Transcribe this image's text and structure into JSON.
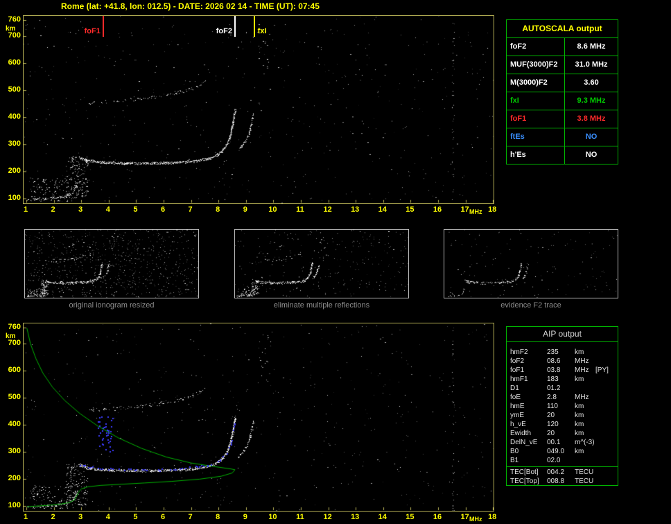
{
  "header": {
    "title": "Rome (lat: +41.8, lon: 012.5) - DATE: 2026 02 14 - TIME (UT): 07:45"
  },
  "colors": {
    "background": "#000000",
    "axis_label": "#FFFF00",
    "plot_border": "#B9B356",
    "table_border": "#00B400",
    "caption_gray": "#8C8C8C",
    "foF1_red": "#FF2A2A",
    "fxI_green": "#00CC00",
    "ftEs_blue": "#3A8FFF",
    "profile_green": "#00B400",
    "restored_blue": "#3C3CFF"
  },
  "autoscala": {
    "header": "AUTOSCALA output",
    "rows": [
      {
        "label": "foF2",
        "value": "8.6 MHz",
        "color": "#FFFFFF"
      },
      {
        "label": "MUF(3000)F2",
        "value": "31.0 MHz",
        "color": "#FFFFFF"
      },
      {
        "label": "M(3000)F2",
        "value": "3.60",
        "color": "#FFFFFF"
      },
      {
        "label": "fxI",
        "value": "9.3 MHz",
        "color": "#00CC00"
      },
      {
        "label": "foF1",
        "value": "3.8 MHz",
        "color": "#FF2A2A"
      },
      {
        "label": "ftEs",
        "value": "NO",
        "color": "#3A8FFF"
      },
      {
        "label": "h'Es",
        "value": "NO",
        "color": "#FFFFFF"
      }
    ]
  },
  "thumbnails": [
    {
      "caption": "original ionogram resized"
    },
    {
      "caption": "eliminate multiple reflections"
    },
    {
      "caption": "evidence F2 trace"
    }
  ],
  "aip": {
    "header": "AIP output",
    "rows": [
      {
        "label": "hmF2",
        "value": "235",
        "unit": "km",
        "extra": ""
      },
      {
        "label": "foF2",
        "value": "08.6",
        "unit": "MHz",
        "extra": ""
      },
      {
        "label": "foF1",
        "value": "03.8",
        "unit": "MHz",
        "extra": "[PY]"
      },
      {
        "label": "hmF1",
        "value": "183",
        "unit": "km",
        "extra": ""
      },
      {
        "label": "D1",
        "value": "01.2",
        "unit": "",
        "extra": ""
      },
      {
        "label": "foE",
        "value": "2.8",
        "unit": "MHz",
        "extra": ""
      },
      {
        "label": "hmE",
        "value": "110",
        "unit": "km",
        "extra": ""
      },
      {
        "label": "ymE",
        "value": "20",
        "unit": "km",
        "extra": ""
      },
      {
        "label": "h_vE",
        "value": "120",
        "unit": "km",
        "extra": ""
      },
      {
        "label": "Ewidth",
        "value": "20",
        "unit": "km",
        "extra": ""
      },
      {
        "label": "DelN_vE",
        "value": "00.1",
        "unit": "m^(-3)",
        "extra": ""
      },
      {
        "label": "B0",
        "value": "049.0",
        "unit": "km",
        "extra": ""
      },
      {
        "label": "B1",
        "value": "02.0",
        "unit": "",
        "extra": ""
      }
    ],
    "tec_rows": [
      {
        "label": "TEC[Bot]",
        "value": "004.2",
        "unit": "TECU"
      },
      {
        "label": "TEC[Top]",
        "value": "008.8",
        "unit": "TECU"
      }
    ]
  },
  "chart_data": {
    "type": "scatter",
    "title": "Vertical incidence ionogram: virtual height (km) vs sounding frequency (MHz)",
    "x_axis": {
      "label": "MHz",
      "min": 1,
      "max": 18,
      "ticks": [
        "1",
        "2",
        "3",
        "4",
        "5",
        "6",
        "7",
        "8",
        "9",
        "10",
        "11",
        "12",
        "13",
        "14",
        "15",
        "16",
        "17",
        "18"
      ]
    },
    "y_axis": {
      "label": "km",
      "min": 100,
      "max": 760,
      "ticks": [
        "760",
        "700",
        "600",
        "500",
        "400",
        "300",
        "200",
        "100"
      ]
    },
    "markers": [
      {
        "name": "foF1",
        "freq_mhz": 3.8,
        "color": "#FF2A2A",
        "side": "left"
      },
      {
        "name": "foF2",
        "freq_mhz": 8.6,
        "color": "#FFFFFF",
        "side": "left"
      },
      {
        "name": "fxI",
        "freq_mhz": 9.3,
        "color": "#FFFF00",
        "side": "right"
      }
    ],
    "traces": {
      "e_layer": {
        "points": [
          [
            1.05,
            95
          ],
          [
            1.5,
            98
          ],
          [
            2.0,
            102
          ],
          [
            2.35,
            107
          ],
          [
            2.6,
            116
          ],
          [
            2.75,
            130
          ],
          [
            2.85,
            155
          ]
        ],
        "density": 0.5,
        "jitter": 3,
        "passes": 2
      },
      "f_ordinary": {
        "points": [
          [
            2.95,
            252
          ],
          [
            3.2,
            240
          ],
          [
            3.8,
            233
          ],
          [
            4.6,
            230
          ],
          [
            5.6,
            230
          ],
          [
            6.6,
            233
          ],
          [
            7.2,
            238
          ],
          [
            7.7,
            248
          ],
          [
            8.0,
            262
          ],
          [
            8.2,
            282
          ],
          [
            8.35,
            308
          ],
          [
            8.45,
            340
          ],
          [
            8.52,
            375
          ],
          [
            8.58,
            410
          ],
          [
            8.62,
            428
          ]
        ],
        "density": 0.85,
        "jitter": 3.5,
        "passes": 3
      },
      "f_extraordinary": {
        "points": [
          [
            8.72,
            280
          ],
          [
            8.9,
            298
          ],
          [
            9.05,
            325
          ],
          [
            9.15,
            355
          ],
          [
            9.22,
            385
          ],
          [
            9.28,
            415
          ]
        ],
        "density": 0.6,
        "jitter": 3,
        "passes": 2
      },
      "second_order": {
        "points": [
          [
            3.3,
            452
          ],
          [
            4.0,
            458
          ],
          [
            4.7,
            464
          ],
          [
            5.3,
            471
          ],
          [
            5.9,
            479
          ],
          [
            6.4,
            489
          ],
          [
            6.9,
            502
          ],
          [
            7.3,
            518
          ],
          [
            7.55,
            535
          ]
        ],
        "density": 0.45,
        "jitter": 5,
        "passes": 1
      }
    },
    "clusters": [
      {
        "f": [
          1.15,
          2.75
        ],
        "km": [
          88,
          175
        ],
        "count": 120
      },
      {
        "f": [
          2.45,
          3.25
        ],
        "km": [
          100,
          255
        ],
        "count": 160
      },
      {
        "f": [
          9.4,
          9.9
        ],
        "km": [
          560,
          750
        ],
        "count": 20
      }
    ],
    "noise": {
      "speck_count": 560,
      "columns": [
        16.55
      ]
    },
    "profile_green": {
      "color": "#00B400",
      "points": [
        [
          1.02,
          758
        ],
        [
          1.15,
          700
        ],
        [
          1.35,
          645
        ],
        [
          1.6,
          592
        ],
        [
          1.95,
          540
        ],
        [
          2.4,
          490
        ],
        [
          2.95,
          442
        ],
        [
          3.6,
          396
        ],
        [
          4.35,
          352
        ],
        [
          5.2,
          313
        ],
        [
          6.1,
          281
        ],
        [
          7.0,
          259
        ],
        [
          7.9,
          245
        ],
        [
          8.45,
          237
        ],
        [
          8.6,
          234
        ],
        [
          8.5,
          222
        ],
        [
          8.1,
          210
        ],
        [
          7.3,
          199
        ],
        [
          6.3,
          191
        ],
        [
          5.3,
          185
        ],
        [
          4.4,
          180
        ],
        [
          3.7,
          176
        ],
        [
          3.25,
          171
        ],
        [
          3.0,
          163
        ],
        [
          2.9,
          150
        ],
        [
          2.82,
          135
        ],
        [
          2.75,
          122
        ],
        [
          2.55,
          112
        ],
        [
          2.2,
          106
        ],
        [
          1.75,
          102
        ],
        [
          1.3,
          99
        ],
        [
          1.02,
          97
        ]
      ]
    },
    "blue_restored": {
      "color": "#3C3CFF",
      "points": [
        [
          2.95,
          250
        ],
        [
          3.4,
          242
        ],
        [
          4.0,
          237
        ],
        [
          4.8,
          234
        ],
        [
          5.8,
          234
        ],
        [
          6.8,
          240
        ],
        [
          7.6,
          252
        ],
        [
          8.05,
          270
        ],
        [
          8.3,
          296
        ],
        [
          8.45,
          330
        ],
        [
          8.52,
          365
        ],
        [
          8.58,
          400
        ],
        [
          8.62,
          425
        ]
      ],
      "cluster": {
        "f": [
          3.6,
          4.15
        ],
        "km": [
          300,
          430
        ],
        "count": 40
      }
    },
    "scaled_values": {
      "foF2_mhz": 8.6,
      "MUF3000F2_mhz": 31.0,
      "M3000F2": 3.6,
      "fxI_mhz": 9.3,
      "foF1_mhz": 3.8,
      "hmF2_km": 235,
      "hmF1_km": 183,
      "foE_mhz": 2.8,
      "hmE_km": 110
    }
  }
}
